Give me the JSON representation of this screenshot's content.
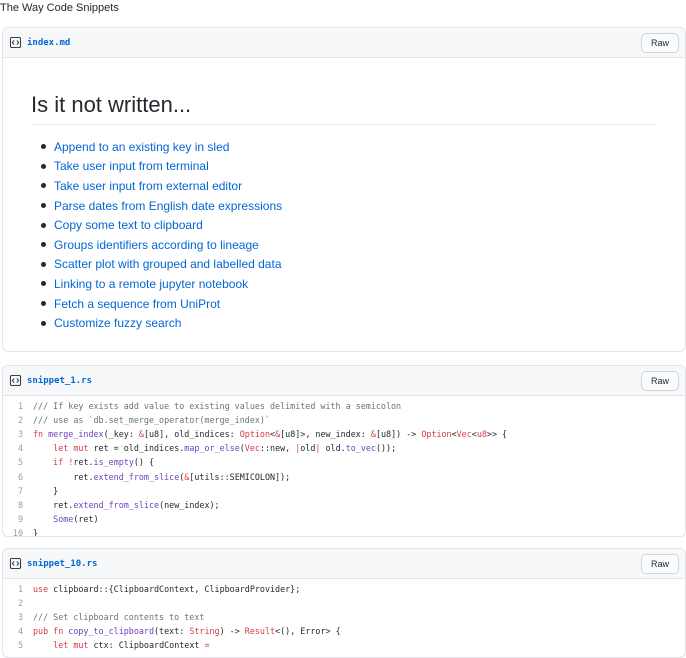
{
  "page": {
    "title": "The Way Code Snippets"
  },
  "cards": [
    {
      "filename": "index.md",
      "raw_label": "Raw",
      "heading": "Is it not written...",
      "links": [
        "Append to an existing key in sled",
        "Take user input from terminal",
        "Take user input from external editor",
        "Parse dates from English date expressions",
        "Copy some text to clipboard",
        "Groups identifiers according to lineage",
        "Scatter plot with grouped and labelled data",
        "Linking to a remote jupyter notebook",
        "Fetch a sequence from UniProt",
        "Customize fuzzy search"
      ]
    },
    {
      "filename": "snippet_1.rs",
      "raw_label": "Raw",
      "lines": [
        [
          {
            "t": "c",
            "v": "/// If key exists add value to existing values delimited with a semicolon"
          }
        ],
        [
          {
            "t": "c",
            "v": "/// use as `db.set_merge_operator(merge_index)`"
          }
        ],
        [
          {
            "t": "k",
            "v": "fn "
          },
          {
            "t": "f",
            "v": "merge_index"
          },
          {
            "t": "p",
            "v": "(_key: "
          },
          {
            "t": "k",
            "v": "&"
          },
          {
            "t": "p",
            "v": "[u8], old_indices: "
          },
          {
            "t": "k",
            "v": "Option"
          },
          {
            "t": "p",
            "v": "<"
          },
          {
            "t": "k",
            "v": "&"
          },
          {
            "t": "p",
            "v": "[u8]>, new_index: "
          },
          {
            "t": "k",
            "v": "&"
          },
          {
            "t": "p",
            "v": "[u8]) -> "
          },
          {
            "t": "k",
            "v": "Option"
          },
          {
            "t": "p",
            "v": "<"
          },
          {
            "t": "k",
            "v": "Vec"
          },
          {
            "t": "p",
            "v": "<"
          },
          {
            "t": "k",
            "v": "u8"
          },
          {
            "t": "p",
            "v": ">> {"
          }
        ],
        [
          {
            "t": "p",
            "v": "    "
          },
          {
            "t": "k",
            "v": "let mut "
          },
          {
            "t": "p",
            "v": "ret = old_indices."
          },
          {
            "t": "f",
            "v": "map_or_else"
          },
          {
            "t": "p",
            "v": "("
          },
          {
            "t": "k",
            "v": "Vec"
          },
          {
            "t": "p",
            "v": "::new, "
          },
          {
            "t": "k",
            "v": "|"
          },
          {
            "t": "p",
            "v": "old"
          },
          {
            "t": "k",
            "v": "|"
          },
          {
            "t": "p",
            "v": " old."
          },
          {
            "t": "f",
            "v": "to_vec"
          },
          {
            "t": "p",
            "v": "());"
          }
        ],
        [
          {
            "t": "p",
            "v": "    "
          },
          {
            "t": "k",
            "v": "if "
          },
          {
            "t": "k",
            "v": "!"
          },
          {
            "t": "p",
            "v": "ret."
          },
          {
            "t": "f",
            "v": "is_empty"
          },
          {
            "t": "p",
            "v": "() {"
          }
        ],
        [
          {
            "t": "p",
            "v": "        ret."
          },
          {
            "t": "f",
            "v": "extend_from_slice"
          },
          {
            "t": "p",
            "v": "("
          },
          {
            "t": "k",
            "v": "&"
          },
          {
            "t": "p",
            "v": "[utils::SEMICOLON]);"
          }
        ],
        [
          {
            "t": "p",
            "v": "    }"
          }
        ],
        [
          {
            "t": "p",
            "v": "    ret."
          },
          {
            "t": "f",
            "v": "extend_from_slice"
          },
          {
            "t": "p",
            "v": "(new_index);"
          }
        ],
        [
          {
            "t": "p",
            "v": "    "
          },
          {
            "t": "f",
            "v": "Some"
          },
          {
            "t": "p",
            "v": "(ret)"
          }
        ],
        [
          {
            "t": "p",
            "v": "}"
          }
        ]
      ]
    },
    {
      "filename": "snippet_10.rs",
      "raw_label": "Raw",
      "lines": [
        [
          {
            "t": "k",
            "v": "use "
          },
          {
            "t": "p",
            "v": "clipboard::{ClipboardContext, ClipboardProvider};"
          }
        ],
        [
          {
            "t": "p",
            "v": ""
          }
        ],
        [
          {
            "t": "c",
            "v": "/// Set clipboard contents to text"
          }
        ],
        [
          {
            "t": "k",
            "v": "pub fn "
          },
          {
            "t": "f",
            "v": "copy_to_clipboard"
          },
          {
            "t": "p",
            "v": "(text: "
          },
          {
            "t": "k",
            "v": "String"
          },
          {
            "t": "p",
            "v": ") -> "
          },
          {
            "t": "k",
            "v": "Result"
          },
          {
            "t": "p",
            "v": "<(), Error> {"
          }
        ],
        [
          {
            "t": "p",
            "v": "    "
          },
          {
            "t": "k",
            "v": "let mut "
          },
          {
            "t": "p",
            "v": "ctx: ClipboardContext "
          },
          {
            "t": "k",
            "v": "="
          }
        ]
      ]
    }
  ]
}
